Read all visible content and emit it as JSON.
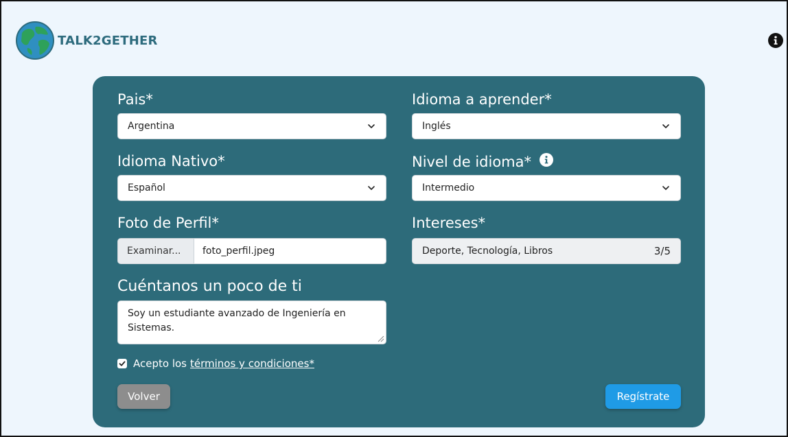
{
  "app": {
    "name": "TALK2GETHER"
  },
  "form": {
    "country": {
      "label": "Pais*",
      "value": "Argentina"
    },
    "learn_language": {
      "label": "Idioma a aprender*",
      "value": "Inglés"
    },
    "native_language": {
      "label": "Idioma Nativo*",
      "value": "Español"
    },
    "language_level": {
      "label": "Nivel de idioma*",
      "value": "Intermedio"
    },
    "profile_photo": {
      "label": "Foto de Perfil*",
      "button": "Examinar...",
      "filename": "foto_perfil.jpeg"
    },
    "interests": {
      "label": "Intereses*",
      "value": "Deporte, Tecnología, Libros",
      "count": "3/5"
    },
    "about": {
      "label": "Cuéntanos un poco de ti",
      "value": "Soy un estudiante avanzado de Ingeniería en Sistemas."
    },
    "terms": {
      "prefix": "Acepto los",
      "link": "términos y condiciones*",
      "checked": true
    },
    "back_button": "Volver",
    "register_button": "Regístrate"
  },
  "colors": {
    "card": "#2d6b7a",
    "background": "#eef6fd",
    "register": "#1f9be6",
    "back": "#8d8d8d"
  },
  "icons": {
    "logo": "globe-icon",
    "info": "info-icon",
    "chevron": "chevron-down-icon"
  }
}
